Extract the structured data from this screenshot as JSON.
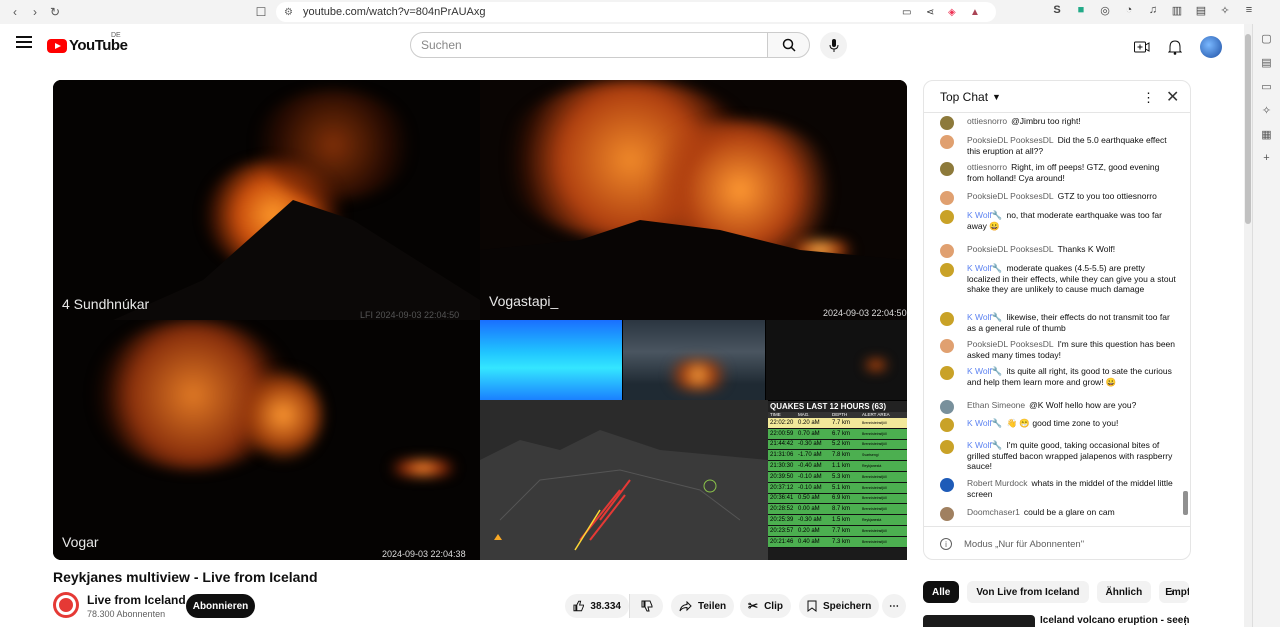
{
  "browser": {
    "url": "youtube.com/watch?v=804nPrAUAxg"
  },
  "header": {
    "brand": "YouTube",
    "region": "DE",
    "search_placeholder": "Suchen"
  },
  "video": {
    "title": "Reykjanes multiview - Live from Iceland",
    "cams": {
      "cam1_label": "4 Sundhnúkar",
      "cam1_ts": "LFI 2024-09-03 22:04:50",
      "cam2_label": "Vogastapi_",
      "cam2_ts": "2024-09-03 22:04:50",
      "cam3_label": "Vogar",
      "cam3_ts": "2024-09-03 22:04:38"
    },
    "quakes": {
      "title": "QUAKES LAST 12 HOURS (63)",
      "columns": [
        "TIME",
        "MAG.",
        "DEPTH",
        "ALERT AREA"
      ],
      "rows": [
        [
          "22:02:20",
          "0.20 aM",
          "7.7 km",
          "Brennisteinsfjöll"
        ],
        [
          "22:00:59",
          "0.70 aM",
          "6.7 km",
          "Brennisteinsfjöll"
        ],
        [
          "21:44:42",
          "-0.30 aM",
          "5.2 km",
          "Brennisteinsfjöll"
        ],
        [
          "21:31:06",
          "-1.70 aM",
          "7.8 km",
          "Svartsengi"
        ],
        [
          "21:30:30",
          "-0.40 aM",
          "1.1 km",
          "Reykjanestá"
        ],
        [
          "20:39:50",
          "-0.10 aM",
          "5.3 km",
          "Brennisteinsfjöll"
        ],
        [
          "20:37:12",
          "-0.10 aM",
          "5.1 km",
          "Brennisteinsfjöll"
        ],
        [
          "20:36:41",
          "0.50 aM",
          "6.9 km",
          "Brennisteinsfjöll"
        ],
        [
          "20:28:52",
          "0.00 aM",
          "8.7 km",
          "Brennisteinsfjöll"
        ],
        [
          "20:25:39",
          "-0.30 aM",
          "1.5 km",
          "Reykjanestá"
        ],
        [
          "20:23:57",
          "0.20 aM",
          "7.7 km",
          "Brennisteinsfjöll"
        ],
        [
          "20:21:46",
          "0.40 aM",
          "7.3 km",
          "Brennisteinsfjöll"
        ]
      ]
    }
  },
  "channel": {
    "name": "Live from Iceland",
    "subscribers": "78.300 Abonnenten",
    "subscribe_label": "Abonnieren"
  },
  "actions": {
    "likes": "38.334",
    "share": "Teilen",
    "clip": "Clip",
    "save": "Speichern"
  },
  "chat": {
    "header": "Top Chat",
    "footer": "Modus „Nur für Abonnenten\"",
    "messages": [
      {
        "author": "ottiesnorro",
        "text": "@Jimbru too right!",
        "mod": false,
        "avatar_color": "#8d7a3b"
      },
      {
        "author": "PooksieDL PooksesDL",
        "text": "Did the 5.0 earthquake effect this eruption at all??",
        "mod": false,
        "avatar_color": "#e0a070"
      },
      {
        "author": "ottiesnorro",
        "text": "Right, im off peeps! GTZ, good evening from holland! Cya around!",
        "mod": false,
        "avatar_color": "#8d7a3b"
      },
      {
        "author": "PooksieDL PooksesDL",
        "text": "GTZ to you too ottiesnorro",
        "mod": false,
        "avatar_color": "#e0a070"
      },
      {
        "author": "K Wolf🔧",
        "text": "no, that moderate earthquake was too far away 😀",
        "mod": true,
        "avatar_color": "#c9a227"
      },
      {
        "author": "PooksieDL PooksesDL",
        "text": "Thanks K Wolf!",
        "mod": false,
        "avatar_color": "#e0a070"
      },
      {
        "author": "K Wolf🔧",
        "text": "moderate quakes (4.5-5.5) are pretty localized in their effects, while they can give you a stout shake they are unlikely to cause much damage",
        "mod": true,
        "avatar_color": "#c9a227"
      },
      {
        "author": "K Wolf🔧",
        "text": "likewise, their effects do not transmit too far as a general rule of thumb",
        "mod": true,
        "avatar_color": "#c9a227"
      },
      {
        "author": "PooksieDL PooksesDL",
        "text": "I'm sure this question has been asked many times today!",
        "mod": false,
        "avatar_color": "#e0a070"
      },
      {
        "author": "K Wolf🔧",
        "text": "its quite all right, its good to sate the curious and help them learn more and grow! 😀",
        "mod": true,
        "avatar_color": "#c9a227"
      },
      {
        "author": "Ethan Simeone",
        "text": "@K Wolf hello how are you?",
        "mod": false,
        "avatar_color": "#78909c"
      },
      {
        "author": "K Wolf🔧",
        "text": "👋 😁 good time zone to you!",
        "mod": true,
        "avatar_color": "#c9a227"
      },
      {
        "author": "K Wolf🔧",
        "text": "I'm quite good, taking occasional bites of grilled stuffed bacon wrapped jalapenos with raspberry sauce!",
        "mod": true,
        "avatar_color": "#c9a227"
      },
      {
        "author": "Robert Murdock",
        "text": "whats in the middel of the middel little screen",
        "mod": false,
        "avatar_color": "#1e5bb8"
      },
      {
        "author": "Doomchaser1",
        "text": "could be a glare on cam",
        "mod": false,
        "avatar_color": "#a08060"
      }
    ]
  },
  "related": {
    "chips": [
      "Alle",
      "Von Live from Iceland",
      "Ähnlich",
      "Empf"
    ],
    "first_title": "Iceland volcano eruption - seen"
  }
}
